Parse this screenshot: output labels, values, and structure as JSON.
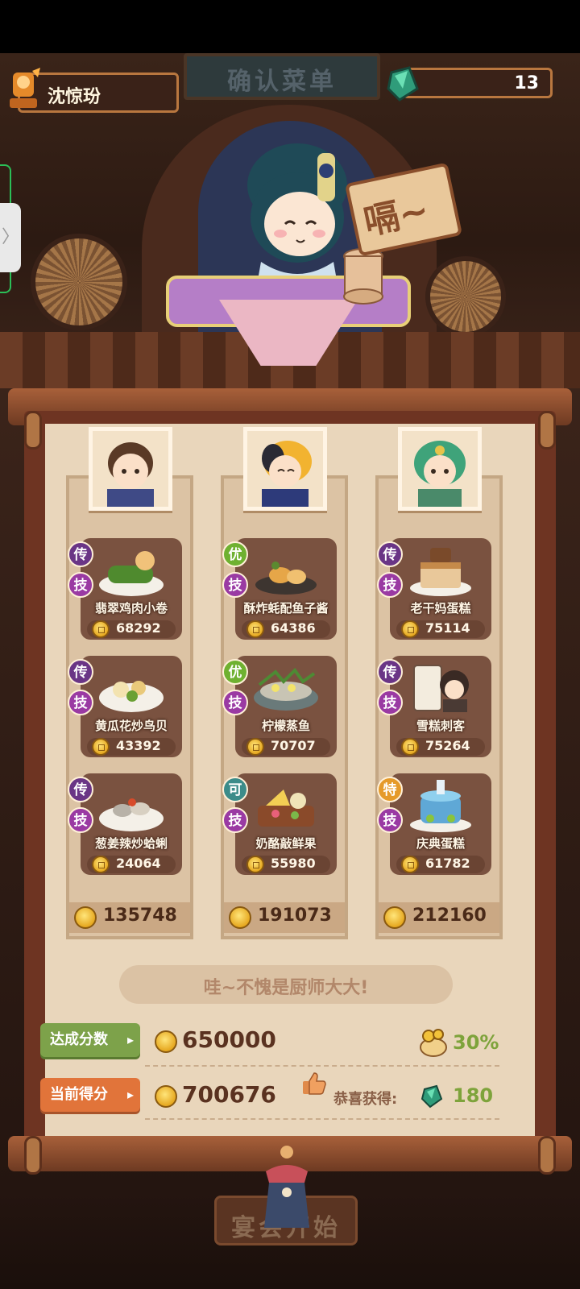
{
  "header": {
    "player_name": "沈惊玢",
    "title_sign": "确认菜单",
    "gems": "13"
  },
  "stage": {
    "speech_text": "嗝~"
  },
  "chefs": [
    {
      "dishes": [
        {
          "name": "翡翠鸡肉小卷",
          "price": "68292",
          "rank": "传",
          "skill": "技"
        },
        {
          "name": "黄瓜花炒鸟贝",
          "price": "43392",
          "rank": "传",
          "skill": "技"
        },
        {
          "name": "葱姜辣炒蛤蜊",
          "price": "24064",
          "rank": "传",
          "skill": "技"
        }
      ],
      "total": "135748"
    },
    {
      "dishes": [
        {
          "name": "酥炸蚝配鱼子酱",
          "price": "64386",
          "rank": "优",
          "skill": "技"
        },
        {
          "name": "柠檬蒸鱼",
          "price": "70707",
          "rank": "优",
          "skill": "技"
        },
        {
          "name": "奶酪敲鲜果",
          "price": "55980",
          "rank": "可",
          "skill": "技"
        }
      ],
      "total": "191073"
    },
    {
      "dishes": [
        {
          "name": "老干妈蛋糕",
          "price": "75114",
          "rank": "传",
          "skill": "技"
        },
        {
          "name": "雪糕刺客",
          "price": "75264",
          "rank": "传",
          "skill": "技"
        },
        {
          "name": "庆典蛋糕",
          "price": "61782",
          "rank": "特",
          "skill": "技"
        }
      ],
      "total": "212160"
    }
  ],
  "summary": {
    "praise": "哇~不愧是厨师大大!",
    "target_label": "达成分数",
    "target_score": "650000",
    "bonus_pct": "30%",
    "current_label": "当前得分",
    "current_score": "700676",
    "reward_label": "恭喜获得:",
    "reward_value": "180"
  },
  "start_button": "宴会开始",
  "colors": {
    "rank_chuan": "#6a3586",
    "rank_you": "#6fb131",
    "rank_ke": "#3c8c8a",
    "rank_te": "#e59a2a",
    "skill": "#9a3aa3",
    "green_text": "#7ea33b"
  },
  "icons": {
    "coin": "coin-icon",
    "gem": "gem-icon",
    "thumbs_up": "thumbs-up-icon",
    "chevron": "chevron-right-icon"
  }
}
